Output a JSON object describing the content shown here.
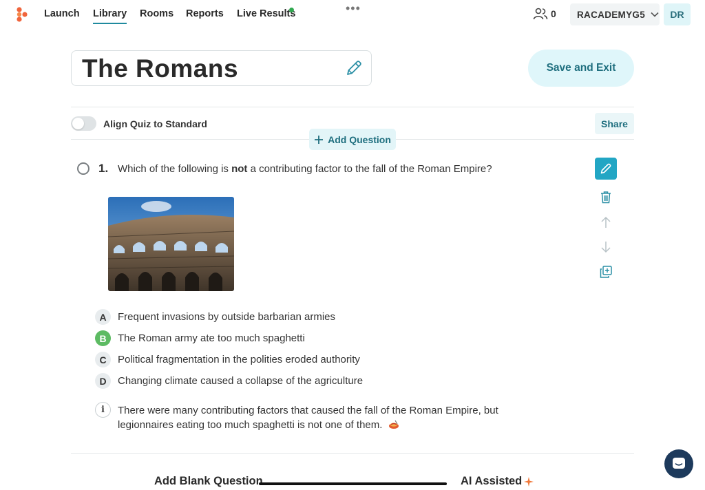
{
  "nav": {
    "items": [
      {
        "label": "Launch"
      },
      {
        "label": "Library"
      },
      {
        "label": "Rooms"
      },
      {
        "label": "Reports"
      },
      {
        "label": "Live Results"
      }
    ],
    "active": "Library",
    "online_count": "0",
    "account_name": "RACADEMYG5",
    "avatar_initials": "DR"
  },
  "quiz": {
    "title": "The Romans",
    "save_exit_label": "Save and Exit",
    "align_label": "Align Quiz to Standard",
    "align_enabled": false,
    "share_label": "Share",
    "add_question_label": "Add Question"
  },
  "question": {
    "number": "1.",
    "text_before": "Which of the following is ",
    "text_bold": "not",
    "text_after": " a contributing factor to the fall of the Roman Empire?",
    "answers": [
      {
        "letter": "A",
        "text": "Frequent invasions by outside barbarian armies",
        "correct": false
      },
      {
        "letter": "B",
        "text": "The Roman army ate too much spaghetti",
        "correct": true
      },
      {
        "letter": "C",
        "text": "Political fragmentation in the polities eroded authority",
        "correct": false
      },
      {
        "letter": "D",
        "text": "Changing climate caused a collapse of the agriculture",
        "correct": false
      }
    ],
    "info_glyph": "i",
    "explanation": "There were many contributing factors that caused the fall of the Roman Empire, but legionnaires eating too much spaghetti is not one of them.",
    "explanation_emoji": "spaghetti-emoji"
  },
  "footer": {
    "add_blank_label": "Add Blank Question",
    "ai_assisted_label": "AI Assisted"
  },
  "colors": {
    "accent": "#22a6c4",
    "accent_text": "#1e6e7e",
    "correct": "#5dbb63",
    "live_dot": "#2fa84f",
    "logo": "#f0643c"
  }
}
